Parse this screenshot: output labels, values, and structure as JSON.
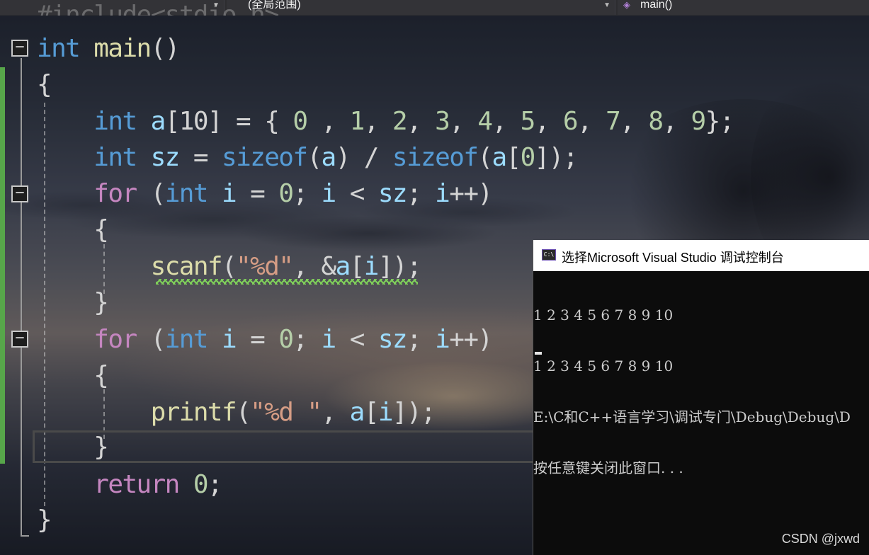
{
  "navbar": {
    "combo1": "",
    "combo2": "(全局范围)",
    "combo3": "main()"
  },
  "code": {
    "line0": "#include<stdio.h>",
    "line1": [
      "int",
      " main",
      "()"
    ],
    "line2": "{",
    "line3": [
      "    ",
      "int",
      " a",
      "[10] = { ",
      "0",
      " , ",
      "1",
      ", ",
      "2",
      ", ",
      "3",
      ", ",
      "4",
      ", ",
      "5",
      ", ",
      "6",
      ", ",
      "7",
      ", ",
      "8",
      ", ",
      "9",
      "};"
    ],
    "line4": [
      "    ",
      "int",
      " sz",
      " = ",
      "sizeof",
      "(",
      "a",
      ") / ",
      "sizeof",
      "(",
      "a",
      "[",
      "0",
      "]);"
    ],
    "line5": [
      "    ",
      "for",
      " (",
      "int",
      " i",
      " = ",
      "0",
      "; ",
      "i",
      " < ",
      "sz",
      "; ",
      "i",
      "++)"
    ],
    "line6": "    {",
    "line7": [
      "        ",
      "scanf",
      "(",
      "\"%d\"",
      ", &",
      "a",
      "[",
      "i",
      "]);"
    ],
    "line8": "    }",
    "line9": [
      "    ",
      "for",
      " (",
      "int",
      " i",
      " = ",
      "0",
      "; ",
      "i",
      " < ",
      "sz",
      "; ",
      "i",
      "++)"
    ],
    "line10": "    {",
    "line11": [
      "        ",
      "printf",
      "(",
      "\"%d \"",
      ", ",
      "a",
      "[",
      "i",
      "]);"
    ],
    "line12": "    }",
    "line13": [
      "    ",
      "return",
      " ",
      "0",
      ";"
    ],
    "line14": "}"
  },
  "console": {
    "title": "选择Microsoft Visual Studio 调试控制台",
    "icon_label": "C:\\",
    "lines": [
      "1 2 3 4 5 6 7 8 9 10",
      "1 2 3 4 5 6 7 8 9 10",
      "E:\\C和C++语言学习\\调试专门\\Debug\\Debug\\D",
      "按任意键关闭此窗口. . ."
    ]
  },
  "watermark": "CSDN @jxwd",
  "colors": {
    "keyword": "#569cd6",
    "control": "#c586c0",
    "function": "#dcdcaa",
    "variable": "#9cdcfe",
    "number": "#b5cea8",
    "string": "#d69d85",
    "console_bg": "#0c0c0c"
  }
}
